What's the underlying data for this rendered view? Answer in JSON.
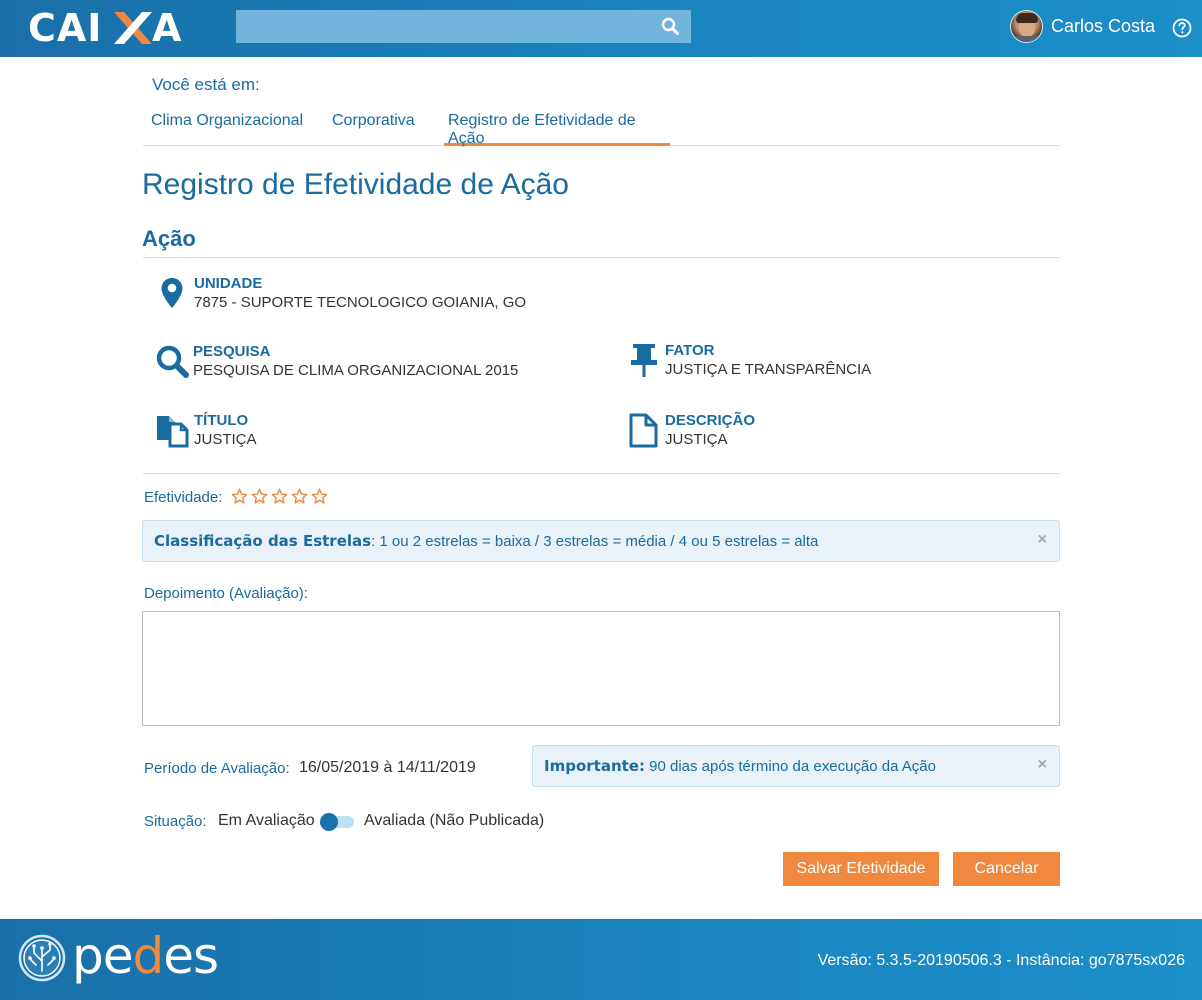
{
  "header": {
    "logo_text": "CAIXA",
    "search": {
      "placeholder": "",
      "value": ""
    },
    "user_name": "Carlos Costa"
  },
  "breadcrumb": {
    "label": "Você está em:",
    "items": [
      {
        "label": "Clima Organizacional"
      },
      {
        "label": "Corporativa"
      },
      {
        "label": "Registro de Efetividade de Ação",
        "active": true
      }
    ]
  },
  "page_title": "Registro de Efetividade de Ação",
  "section_title": "Ação",
  "info": {
    "unidade": {
      "label": "UNIDADE",
      "value": "7875 - SUPORTE TECNOLOGICO GOIANIA, GO",
      "icon": "map-marker-icon"
    },
    "pesquisa": {
      "label": "PESQUISA",
      "value": "PESQUISA DE CLIMA ORGANIZACIONAL 2015",
      "icon": "search-icon"
    },
    "fator": {
      "label": "FATOR",
      "value": "JUSTIÇA E TRANSPARÊNCIA",
      "icon": "pushpin-icon"
    },
    "titulo": {
      "label": "TÍTULO",
      "value": "JUSTIÇA",
      "icon": "copy-icon"
    },
    "descricao": {
      "label": "DESCRIÇÃO",
      "value": "JUSTIÇA",
      "icon": "file-icon"
    }
  },
  "efetividade": {
    "label": "Efetividade:",
    "rating": 0,
    "max_rating": 5
  },
  "alert_stars": {
    "title": "Classificação das Estrelas",
    "text": ": 1 ou 2 estrelas = baixa / 3 estrelas = média / 4 ou 5 estrelas = alta",
    "close": "×"
  },
  "depoimento": {
    "label": "Depoimento (Avaliação):",
    "value": ""
  },
  "periodo": {
    "label": "Período de Avaliação:",
    "value": "16/05/2019 à 14/11/2019"
  },
  "alert_importante": {
    "title": "Importante:",
    "text": " 90 dias após término da execução da Ação",
    "close": "×"
  },
  "situacao": {
    "label": "Situação:",
    "option_off": "Em Avaliação",
    "option_on": "Avaliada (Não Publicada)",
    "toggled": false
  },
  "buttons": {
    "save": "Salvar Efetividade",
    "cancel": "Cancelar"
  },
  "footer": {
    "brand_pre": "pe",
    "brand_d": "d",
    "brand_post": "es",
    "version_text": "Versão: 5.3.5-20190506.3 - Instância: go7875sx026"
  },
  "colors": {
    "primary": "#1a6ba0",
    "accent": "#f0883e",
    "header_bg": "#1a86c0"
  }
}
